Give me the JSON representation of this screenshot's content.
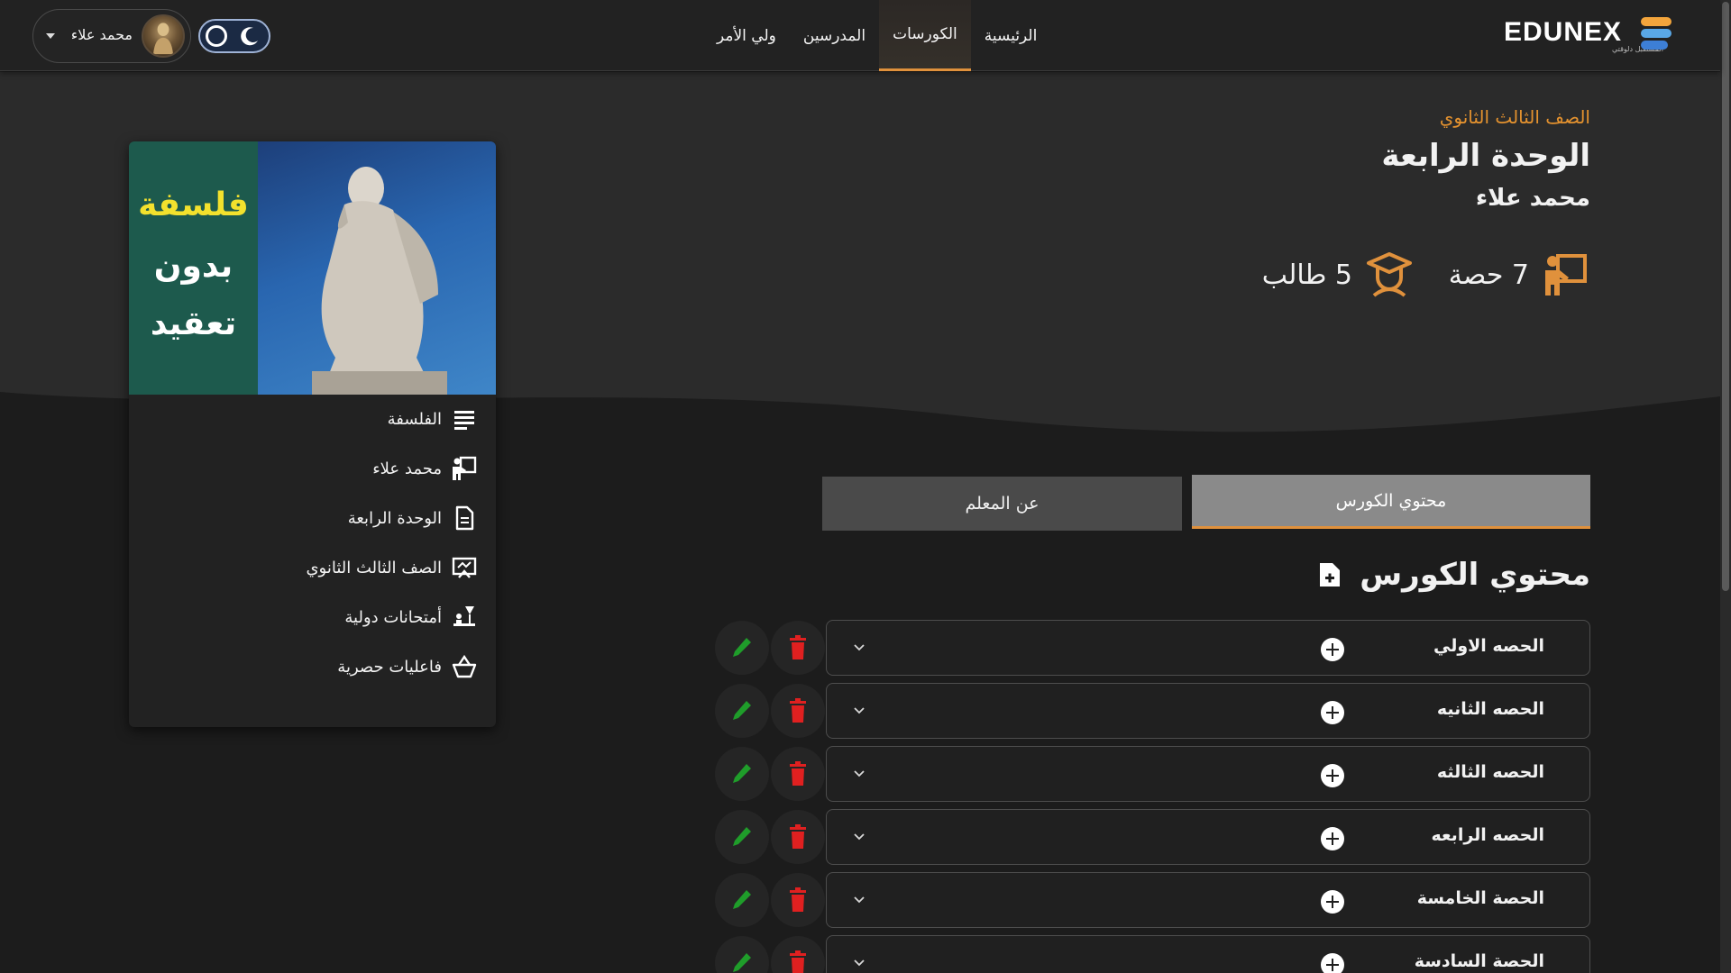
{
  "nav": {
    "logo_text": "EDUNEX",
    "logo_tagline": "المستقبل دلوقتي",
    "links": [
      "الرئيسية",
      "الكورسات",
      "المدرسين",
      "ولي الأمر"
    ],
    "active_link": "الكورسات",
    "user_name": "محمد علاء",
    "theme": "dark"
  },
  "course": {
    "grade": "الصف الثالث الثانوي",
    "unit": "الوحدة الرابعة",
    "teacher": "محمد علاء",
    "lessons_count": "7 حصة",
    "students_count": "5 طالب"
  },
  "card": {
    "cover_text": [
      "فلسفة",
      "بدون",
      "تعقيد"
    ],
    "items": [
      {
        "label": "الفلسفة",
        "icon": "list-icon"
      },
      {
        "label": "محمد علاء",
        "icon": "teacher-icon"
      },
      {
        "label": "الوحدة الرابعة",
        "icon": "document-icon"
      },
      {
        "label": "الصف الثالث الثانوي",
        "icon": "class-board-icon"
      },
      {
        "label": "أمتحانات دولية",
        "icon": "exam-icon"
      },
      {
        "label": "فاعليات حصرية",
        "icon": "basket-icon"
      }
    ]
  },
  "tabs": {
    "content": "محتوي الكورس",
    "about": "عن المعلم"
  },
  "section": {
    "title": "محتوي الكورس"
  },
  "lessons": [
    "الحصه الاولي",
    "الحصه الثانيه",
    "الحصه الثالثه",
    "الحصه الرابعه",
    "الحصة الخامسة",
    "الحصة السادسة"
  ],
  "colors": {
    "accent": "#e0913c",
    "edit": "#1f9d2a",
    "delete": "#e02020",
    "background": "#1c1c1c"
  }
}
